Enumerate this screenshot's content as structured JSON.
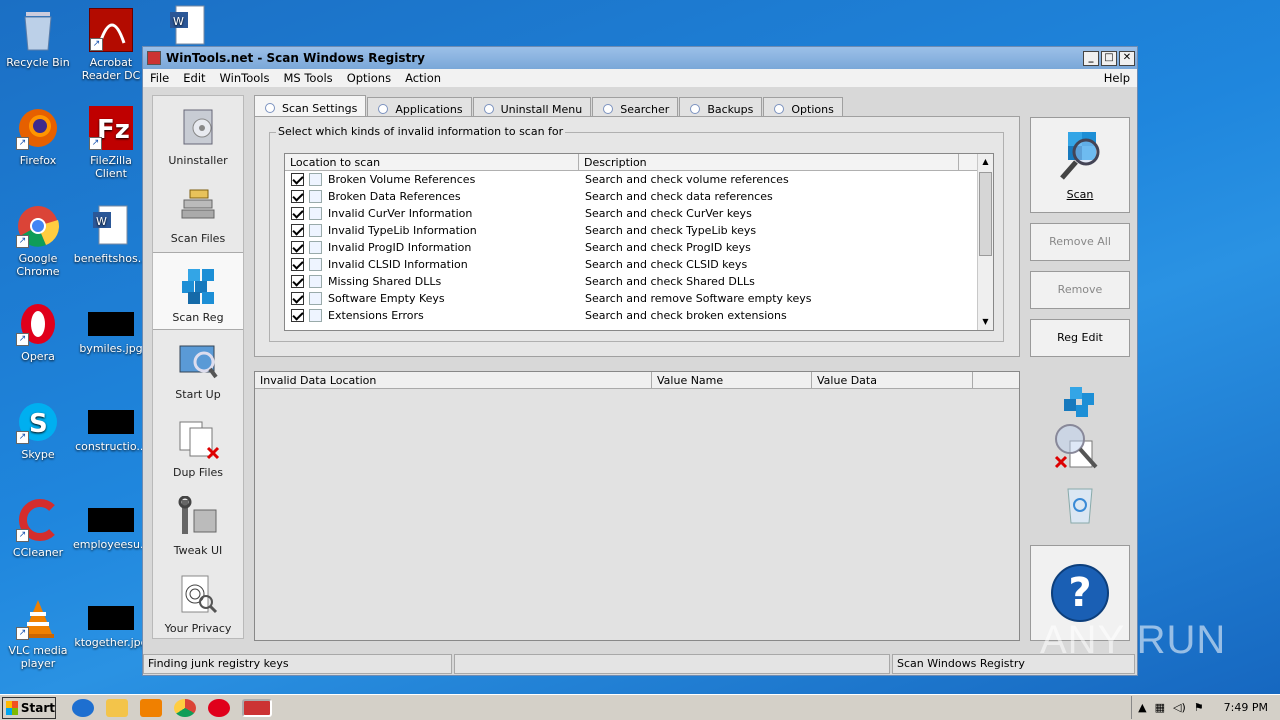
{
  "desktop": {
    "icons": [
      {
        "name": "recycle-bin",
        "label": "Recycle Bin"
      },
      {
        "name": "acrobat",
        "label": "Acrobat Reader DC"
      },
      {
        "name": "firefox",
        "label": "Firefox"
      },
      {
        "name": "filezilla",
        "label": "FileZilla Client"
      },
      {
        "name": "chrome",
        "label": "Google Chrome"
      },
      {
        "name": "benefits",
        "label": "benefitshos..."
      },
      {
        "name": "opera",
        "label": "Opera"
      },
      {
        "name": "bymiles",
        "label": "bymiles.jpg"
      },
      {
        "name": "skype",
        "label": "Skype"
      },
      {
        "name": "construction",
        "label": "constructio..."
      },
      {
        "name": "ccleaner",
        "label": "CCleaner"
      },
      {
        "name": "employees",
        "label": "employeesu..."
      },
      {
        "name": "vlc",
        "label": "VLC media player"
      },
      {
        "name": "ktogether",
        "label": "ktogether.jpg"
      }
    ]
  },
  "window": {
    "title": "WinTools.net - Scan Windows Registry",
    "controls": {
      "minimize": "_",
      "maximize": "□",
      "close": "✕"
    }
  },
  "menu": [
    "File",
    "Edit",
    "WinTools",
    "MS Tools",
    "Options",
    "Action"
  ],
  "menu_help": "Help",
  "nav": [
    {
      "id": "uninstaller",
      "label": "Uninstaller"
    },
    {
      "id": "scan-files",
      "label": "Scan Files"
    },
    {
      "id": "scan-reg",
      "label": "Scan Reg"
    },
    {
      "id": "start-up",
      "label": "Start Up"
    },
    {
      "id": "dup-files",
      "label": "Dup Files"
    },
    {
      "id": "tweak-ui",
      "label": "Tweak UI"
    },
    {
      "id": "your-privacy",
      "label": "Your Privacy"
    }
  ],
  "tabs": [
    "Scan Settings",
    "Applications",
    "Uninstall Menu",
    "Searcher",
    "Backups",
    "Options"
  ],
  "group_label": "Select which kinds of invalid information to scan for",
  "list": {
    "headers": [
      "Location to scan",
      "Description"
    ],
    "rows": [
      {
        "location": "Broken Volume References",
        "description": "Search and check volume references"
      },
      {
        "location": "Broken Data References",
        "description": "Search and check data references"
      },
      {
        "location": "Invalid CurVer Information",
        "description": "Search and check CurVer keys"
      },
      {
        "location": "Invalid TypeLib Information",
        "description": "Search and check TypeLib keys"
      },
      {
        "location": "Invalid ProgID Information",
        "description": "Search and check ProgID keys"
      },
      {
        "location": "Invalid CLSID Information",
        "description": "Search and check CLSID keys"
      },
      {
        "location": "Missing Shared DLLs",
        "description": "Search and check Shared DLLs"
      },
      {
        "location": "Software Empty Keys",
        "description": "Search and remove Software empty keys"
      },
      {
        "location": "Extensions Errors",
        "description": "Search and check broken extensions"
      }
    ]
  },
  "results": {
    "headers": [
      "Invalid Data Location",
      "Value Name",
      "Value Data"
    ]
  },
  "buttons": {
    "scan": "Scan",
    "remove_all": "Remove All",
    "remove": "Remove",
    "reg_edit": "Reg Edit",
    "help": "?"
  },
  "status": {
    "left": "Finding junk registry keys",
    "middle": "",
    "right": "Scan Windows Registry"
  },
  "taskbar": {
    "start": "Start",
    "time": "7:49 PM"
  },
  "watermark": "ANY RUN",
  "colors": {
    "desktop": "#1f86dd",
    "window_title": "#7aa7d8",
    "accent_blue": "#1a5fb4"
  }
}
